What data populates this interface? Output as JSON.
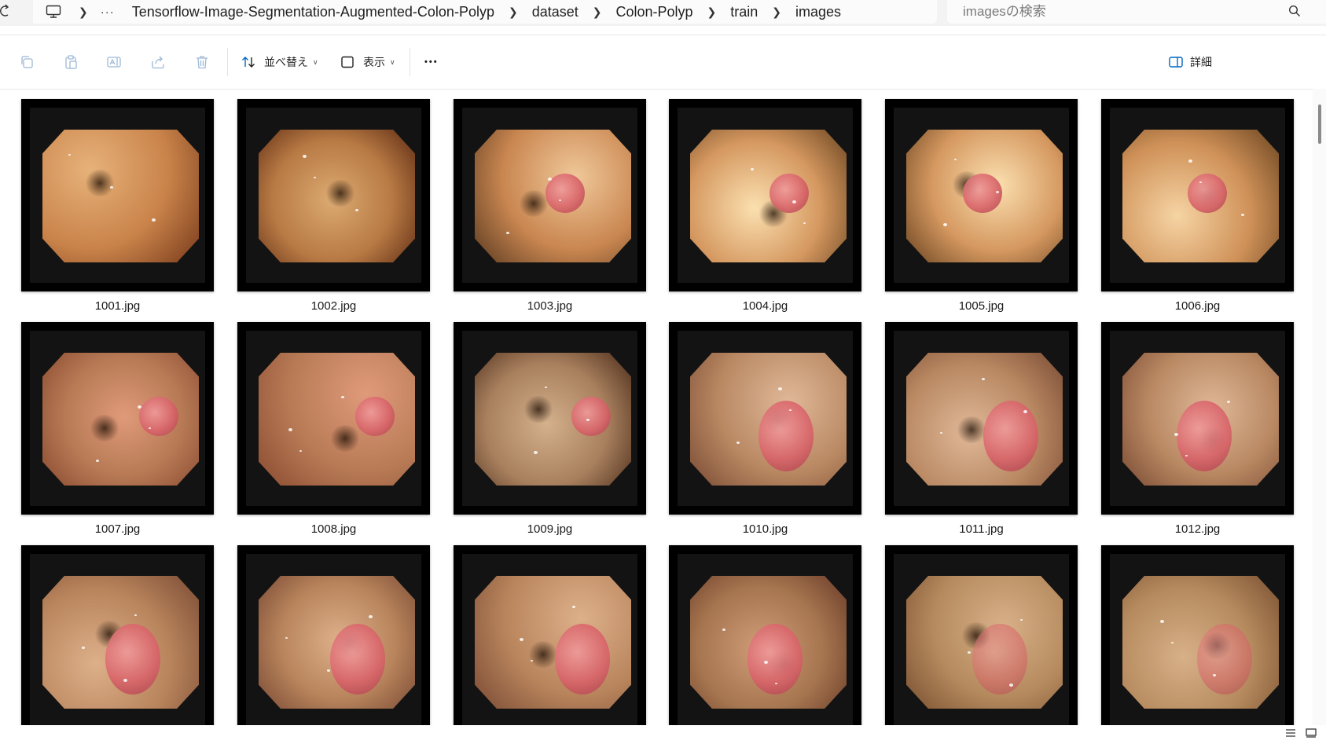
{
  "address": {
    "crumbs": [
      "Tensorflow-Image-Segmentation-Augmented-Colon-Polyp",
      "dataset",
      "Colon-Polyp",
      "train",
      "images"
    ],
    "overflow_label": "···"
  },
  "search": {
    "placeholder": "imagesの検索"
  },
  "toolbar": {
    "sort_label": "並べ替え",
    "view_label": "表示",
    "more_label": "•••",
    "details_label": "詳細"
  },
  "files": [
    {
      "name": "1001.jpg"
    },
    {
      "name": "1002.jpg"
    },
    {
      "name": "1003.jpg"
    },
    {
      "name": "1004.jpg"
    },
    {
      "name": "1005.jpg"
    },
    {
      "name": "1006.jpg"
    },
    {
      "name": "1007.jpg"
    },
    {
      "name": "1008.jpg"
    },
    {
      "name": "1009.jpg"
    },
    {
      "name": "1010.jpg"
    },
    {
      "name": "1011.jpg"
    },
    {
      "name": "1012.jpg"
    },
    {
      "name": ""
    },
    {
      "name": ""
    },
    {
      "name": ""
    },
    {
      "name": ""
    },
    {
      "name": ""
    },
    {
      "name": ""
    }
  ],
  "colors": {
    "accent": "#0067c0",
    "disabled_icon": "#9db8d6"
  }
}
